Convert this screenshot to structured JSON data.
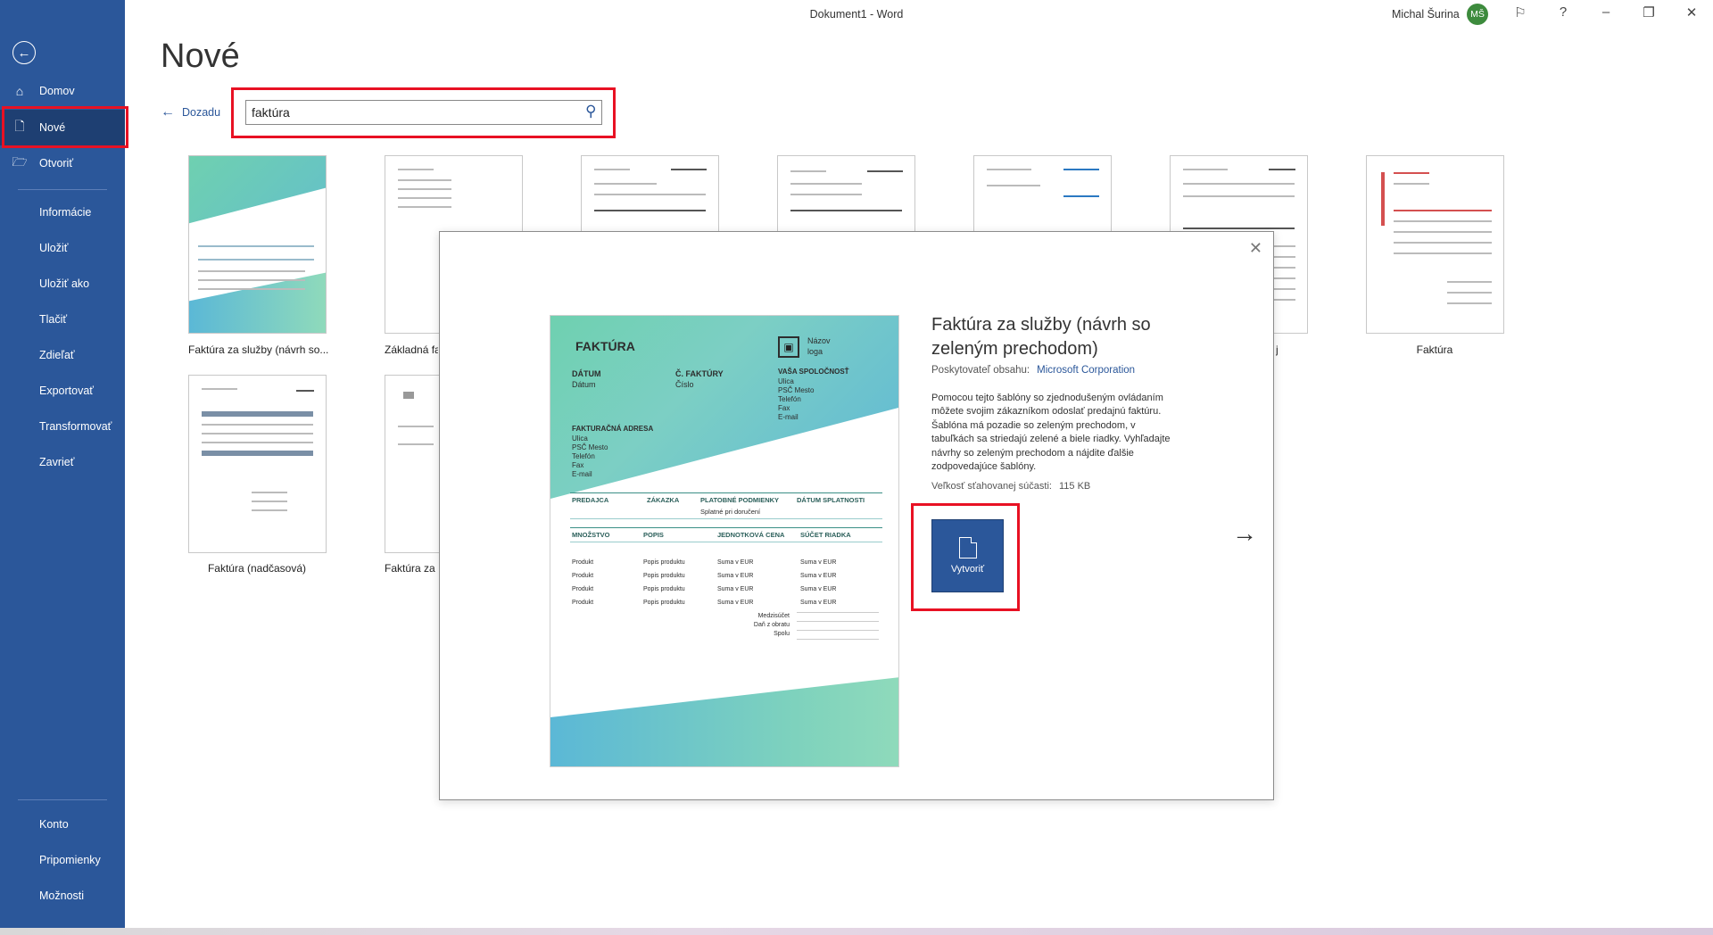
{
  "window": {
    "title": "Dokument1 - Word",
    "user_name": "Michal Šurina",
    "user_initials": "MŠ"
  },
  "sidebar": {
    "items": [
      {
        "label": "Domov"
      },
      {
        "label": "Nové"
      },
      {
        "label": "Otvoriť"
      },
      {
        "label": "Informácie"
      },
      {
        "label": "Uložiť"
      },
      {
        "label": "Uložiť ako"
      },
      {
        "label": "Tlačiť"
      },
      {
        "label": "Zdieľať"
      },
      {
        "label": "Exportovať"
      },
      {
        "label": "Transformovať"
      },
      {
        "label": "Zavrieť"
      }
    ],
    "bottom": [
      {
        "label": "Konto"
      },
      {
        "label": "Pripomienky"
      },
      {
        "label": "Možnosti"
      }
    ]
  },
  "main": {
    "heading": "Nové",
    "back_label": "Dozadu",
    "search_value": "faktúra"
  },
  "templates": [
    {
      "caption": "Faktúra za služby (návrh so..."
    },
    {
      "caption": "Základná fa"
    },
    {
      "caption": "j"
    },
    {
      "caption": "Faktúra"
    },
    {
      "caption": "Faktúra (nadčasová)"
    },
    {
      "caption": "Faktúra za s"
    }
  ],
  "modal": {
    "title": "Faktúra za služby (návrh so zeleným prechodom)",
    "provider_label": "Poskytovateľ obsahu:",
    "provider_name": "Microsoft Corporation",
    "description": "Pomocou tejto šablóny so zjednodušeným ovládaním môžete svojim zákazníkom odoslať predajnú faktúru. Šablóna má pozadie so zeleným prechodom, v tabuľkách sa striedajú zelené a biele riadky. Vyhľadajte návrhy so zeleným prechodom a nájdite ďalšie zodpovedajúce šablóny.",
    "size_label": "Veľkosť sťahovanej súčasti:",
    "size_value": "115 KB",
    "create_label": "Vytvoriť"
  },
  "preview": {
    "title": "FAKTÚRA",
    "logo_text": "Názov loga",
    "date_label": "DÁTUM",
    "date_value": "Dátum",
    "invoice_no_label": "Č. FAKTÚRY",
    "invoice_no_value": "Číslo",
    "company_label": "VAŠA SPOLOČNOSŤ",
    "company_lines": [
      "Ulica",
      "PSČ Mesto",
      "Telefón",
      "Fax",
      "E-mail"
    ],
    "billing_label": "FAKTURAČNÁ ADRESA",
    "billing_lines": [
      "Ulica",
      "PSČ Mesto",
      "Telefón",
      "Fax",
      "E-mail"
    ],
    "row1_headers": [
      "PREDAJCA",
      "ZÁKAZKA",
      "PLATOBNÉ PODMIENKY",
      "DÁTUM SPLATNOSTI"
    ],
    "row1_value": "Splatné pri doručení",
    "row2_headers": [
      "MNOŽSTVO",
      "POPIS",
      "JEDNOTKOVÁ CENA",
      "SÚČET RIADKA"
    ],
    "items": [
      [
        "Produkt",
        "Popis produktu",
        "Suma v EUR",
        "Suma v EUR"
      ],
      [
        "Produkt",
        "Popis produktu",
        "Suma v EUR",
        "Suma v EUR"
      ],
      [
        "Produkt",
        "Popis produktu",
        "Suma v EUR",
        "Suma v EUR"
      ],
      [
        "Produkt",
        "Popis produktu",
        "Suma v EUR",
        "Suma v EUR"
      ]
    ],
    "totals": [
      "Medzisúčet",
      "Daň z obratu",
      "Spolu"
    ]
  }
}
